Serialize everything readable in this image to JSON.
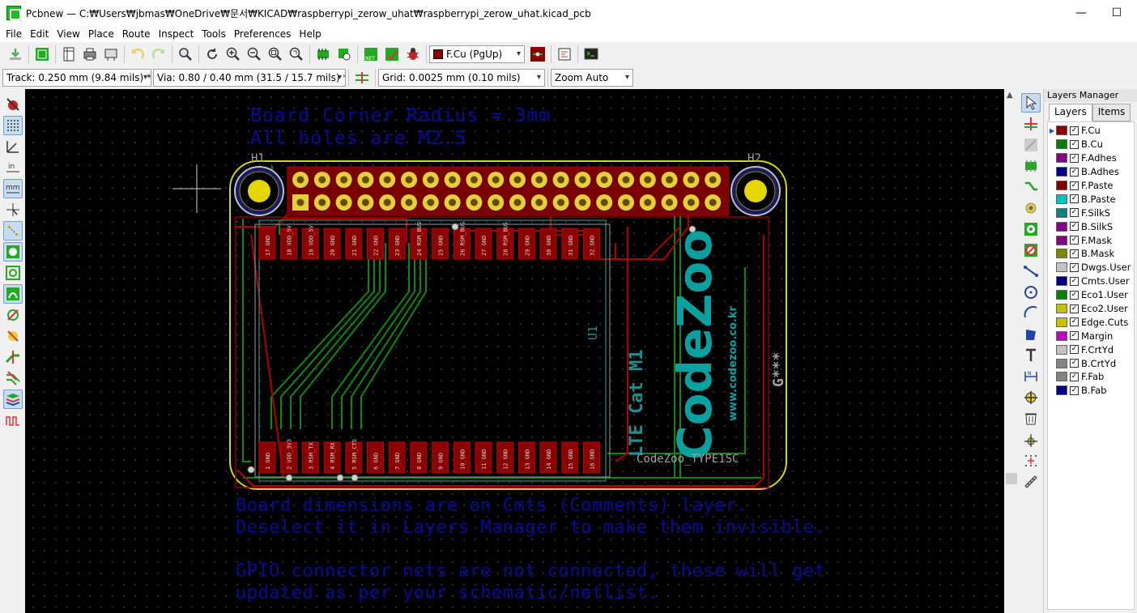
{
  "window": {
    "title": "Pcbnew — C:₩Users₩jbmas₩OneDrive₩문서₩KICAD₩raspberrypi_zerow_uhat₩raspberrypi_zerow_uhat.kicad_pcb",
    "minimize": "—",
    "maximize": "☐"
  },
  "menu": [
    "File",
    "Edit",
    "View",
    "Place",
    "Route",
    "Inspect",
    "Tools",
    "Preferences",
    "Help"
  ],
  "toolbar": {
    "active_layer": "F.Cu (PgUp)"
  },
  "toolbar2": {
    "track": "Track: 0.250 mm (9.84 mils) *",
    "via": "Via: 0.80 / 0.40 mm (31.5 / 15.7 mils) *",
    "grid": "Grid: 0.0025 mm (0.10 mils)",
    "zoom": "Zoom Auto"
  },
  "canvas": {
    "note_top_1": "Board Corner Radius = 3mm",
    "note_top_2": "All holes are M2.5",
    "h1": "H1",
    "h2": "H2",
    "u1": "U1",
    "lte": "LTE Cat M1",
    "codezoo": "CodeZoo",
    "website": "www.codezoo.co.kr",
    "gref": "G***",
    "module_ref": "CodeZoo_TYPE1SC",
    "note_bottom_1": "Board dimensions are on Cmts (Comments) layer.",
    "note_bottom_2": "Deselect it in Layers Manager to make them invisible.",
    "note_bottom_3": "GPIO connector nets are not connected, these will get",
    "note_bottom_4": "updated as per your schematic/netlist.",
    "top_pad_labels": [
      "17 GND",
      "18 VDD_5V",
      "19 VDD_5V",
      "20 GND",
      "21 GND",
      "22 GND",
      "23 GND",
      "24 RSM_BUS",
      "25 GND",
      "26 RSM_BUS",
      "27 GND",
      "28 RSM_BUS",
      "29 GND",
      "30 GND",
      "31 GND",
      "32 GND"
    ],
    "bottom_pad_labels": [
      "1 GND",
      "2 VDD_3V3",
      "3 RSM_TX",
      "4 RSM_RX",
      "5 RSM_CTS",
      "6 GND",
      "7 GND",
      "8 GND",
      "9 GND",
      "10 GND",
      "11 GND",
      "12 GND",
      "13 GND",
      "14 GND",
      "15 GND",
      "16 GND"
    ]
  },
  "layers_panel": {
    "title": "Layers Manager",
    "tabs": [
      "Layers",
      "Items"
    ],
    "layers": [
      {
        "name": "F.Cu",
        "color": "#8b0000"
      },
      {
        "name": "B.Cu",
        "color": "#008000"
      },
      {
        "name": "F.Adhes",
        "color": "#840084"
      },
      {
        "name": "B.Adhes",
        "color": "#000084"
      },
      {
        "name": "F.Paste",
        "color": "#840000"
      },
      {
        "name": "B.Paste",
        "color": "#00c2c2"
      },
      {
        "name": "F.SilkS",
        "color": "#008484"
      },
      {
        "name": "B.SilkS",
        "color": "#840084"
      },
      {
        "name": "F.Mask",
        "color": "#840084"
      },
      {
        "name": "B.Mask",
        "color": "#848400"
      },
      {
        "name": "Dwgs.User",
        "color": "#c2c2c2"
      },
      {
        "name": "Cmts.User",
        "color": "#000084"
      },
      {
        "name": "Eco1.User",
        "color": "#008400"
      },
      {
        "name": "Eco2.User",
        "color": "#c2c200"
      },
      {
        "name": "Edge.Cuts",
        "color": "#c2c200"
      },
      {
        "name": "Margin",
        "color": "#c200c2"
      },
      {
        "name": "F.CrtYd",
        "color": "#c2c2c2"
      },
      {
        "name": "B.CrtYd",
        "color": "#848484"
      },
      {
        "name": "F.Fab",
        "color": "#848484"
      },
      {
        "name": "B.Fab",
        "color": "#000084"
      }
    ]
  }
}
